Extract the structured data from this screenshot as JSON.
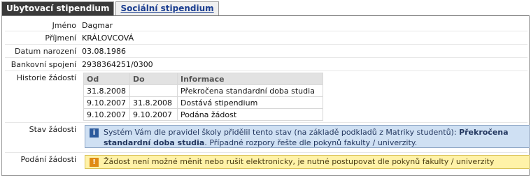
{
  "tabs": [
    {
      "label": "Ubytovací stipendium",
      "active": true
    },
    {
      "label": "Sociální stipendium",
      "active": false
    }
  ],
  "fields": {
    "jmeno": {
      "label": "Jméno",
      "value": "Dagmar"
    },
    "prijmeni": {
      "label": "Příjmení",
      "value": "KRÁLOVCOVÁ"
    },
    "datum": {
      "label": "Datum narození",
      "value": "03.08.1986"
    },
    "bank": {
      "label": "Bankovní spojení",
      "value": "2938364251/0300"
    }
  },
  "history": {
    "label": "Historie žádostí",
    "headers": [
      "Od",
      "Do",
      "Informace"
    ],
    "rows": [
      [
        "31.8.2008",
        "",
        "Překročena standardní doba studia"
      ],
      [
        "9.10.2007",
        "31.8.2008",
        "Dostává stipendium"
      ],
      [
        "9.10.2007",
        "9.10.2007",
        "Podána žádost"
      ]
    ]
  },
  "status": {
    "label": "Stav žádosti",
    "text_prefix": "Systém Vám dle pravidel školy přidělil tento stav (na základě podkladů z Matriky studentů): ",
    "text_bold": "Překročena standardní doba studia",
    "text_suffix": ". Případné rozpory řešte dle pokynů fakulty / univerzity.",
    "icon": "info-icon",
    "color": "#cfe0f3"
  },
  "submission": {
    "label": "Podání žádosti",
    "text": "Žádost není možné měnit nebo rušit elektronicky, je nutné postupovat dle pokynů fakulty / univerzity",
    "icon": "warning-icon",
    "color": "#fff2a8"
  }
}
